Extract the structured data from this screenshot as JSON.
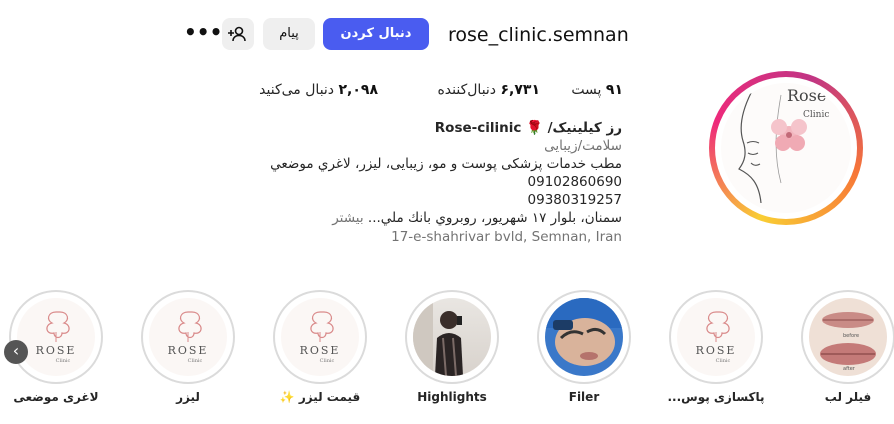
{
  "header": {
    "username": "rose_clinic.semnan",
    "follow_label": "دنبال کردن",
    "message_label": "پیام",
    "suggest_icon": "add-user-icon",
    "more_label": "•••"
  },
  "stats": {
    "posts_count": "۹۱",
    "posts_label": "پست",
    "followers_count": "۶,۷۳۱",
    "followers_label": "دنبال‌کننده",
    "following_count": "۲,۰۹۸",
    "following_label": "دنبال می‌کنید"
  },
  "bio": {
    "name_fa": "رز کیلینیک/",
    "rose_emoji": "🌹",
    "name_en": "Rose-cilinic",
    "category": "سلامت/زیبایی",
    "line1": "مطب خدمات پزشکی پوست و مو، زیبایی، لیزر، لاغري موضعي",
    "phone1": "09102860690",
    "phone2": "09380319257",
    "address": "سمنان، بلوار ۱۷ شهريور، روبروي بانك ملي...",
    "more_label": "بیشتر",
    "location": "17-e-shahrivar bvld, Semnan, Iran"
  },
  "avatar": {
    "brand": "Rose",
    "sub": "Clinic"
  },
  "highlights": [
    {
      "label": "لاغری موضعی",
      "kind": "logo",
      "logo_text": "ROSE",
      "logo_sub": "Clinic"
    },
    {
      "label": "لیزر",
      "kind": "logo",
      "logo_text": "ROSE",
      "logo_sub": "Clinic"
    },
    {
      "label": "قیمت لیزر ✨",
      "kind": "logo",
      "logo_text": "ROSE",
      "logo_sub": "Clinic"
    },
    {
      "label": "Highlights",
      "kind": "photo-person"
    },
    {
      "label": "Filer",
      "kind": "photo-face"
    },
    {
      "label": "پاکسازی پوس...",
      "kind": "logo",
      "logo_text": "ROSE",
      "logo_sub": "Clinic"
    },
    {
      "label": "فیلر لب",
      "kind": "photo-lips",
      "before": "before",
      "after": "after"
    }
  ],
  "colors": {
    "accent": "#4a5cf0",
    "button_bg": "#efefef",
    "muted": "#737373",
    "brand_pink": "#d98a8a"
  }
}
